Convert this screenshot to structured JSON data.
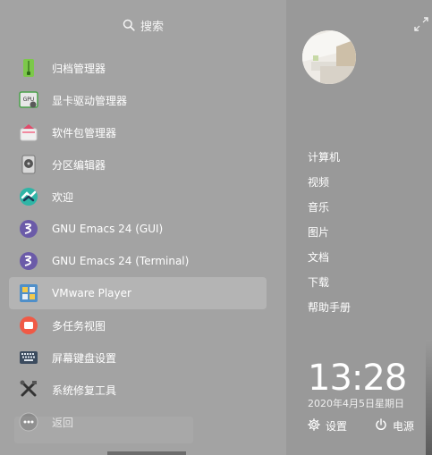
{
  "search": {
    "label": "搜索",
    "icon": "search-icon"
  },
  "apps": [
    {
      "name": "app-archive-manager",
      "label": "归档管理器",
      "icon": "archive-icon",
      "color": "#7cc84a"
    },
    {
      "name": "app-gpu-driver-manager",
      "label": "显卡驱动管理器",
      "icon": "gpu-icon",
      "color": "#4aa14a"
    },
    {
      "name": "app-package-manager",
      "label": "软件包管理器",
      "icon": "package-icon",
      "color": "#e14b6b"
    },
    {
      "name": "app-partition-editor",
      "label": "分区编辑器",
      "icon": "disk-icon",
      "color": "#555555"
    },
    {
      "name": "app-welcome",
      "label": "欢迎",
      "icon": "welcome-icon",
      "color": "#2fb5a6"
    },
    {
      "name": "app-emacs-gui",
      "label": "GNU Emacs 24 (GUI)",
      "icon": "emacs-icon",
      "color": "#6b5ba8"
    },
    {
      "name": "app-emacs-terminal",
      "label": "GNU Emacs 24 (Terminal)",
      "icon": "emacs-icon",
      "color": "#6b5ba8"
    },
    {
      "name": "app-vmware-player",
      "label": "VMware Player",
      "icon": "vmware-icon",
      "color": "#4f8fc9"
    },
    {
      "name": "app-multitask-view",
      "label": "多任务视图",
      "icon": "multitask-icon",
      "color": "#f05a46"
    },
    {
      "name": "app-screen-keyboard",
      "label": "屏幕键盘设置",
      "icon": "keyboard-icon",
      "color": "#3b4b5e"
    },
    {
      "name": "app-system-repair",
      "label": "系统修复工具",
      "icon": "tools-icon",
      "color": "#333333"
    },
    {
      "name": "back-button",
      "label": "返回",
      "icon": "more-icon",
      "color": "#8a8a8a"
    }
  ],
  "places": [
    "计算机",
    "视频",
    "音乐",
    "图片",
    "文档",
    "下载",
    "帮助手册"
  ],
  "clock": {
    "time": "13:28",
    "date": "2020年4月5日星期日"
  },
  "actions": {
    "settings_label": "设置",
    "power_label": "电源"
  }
}
